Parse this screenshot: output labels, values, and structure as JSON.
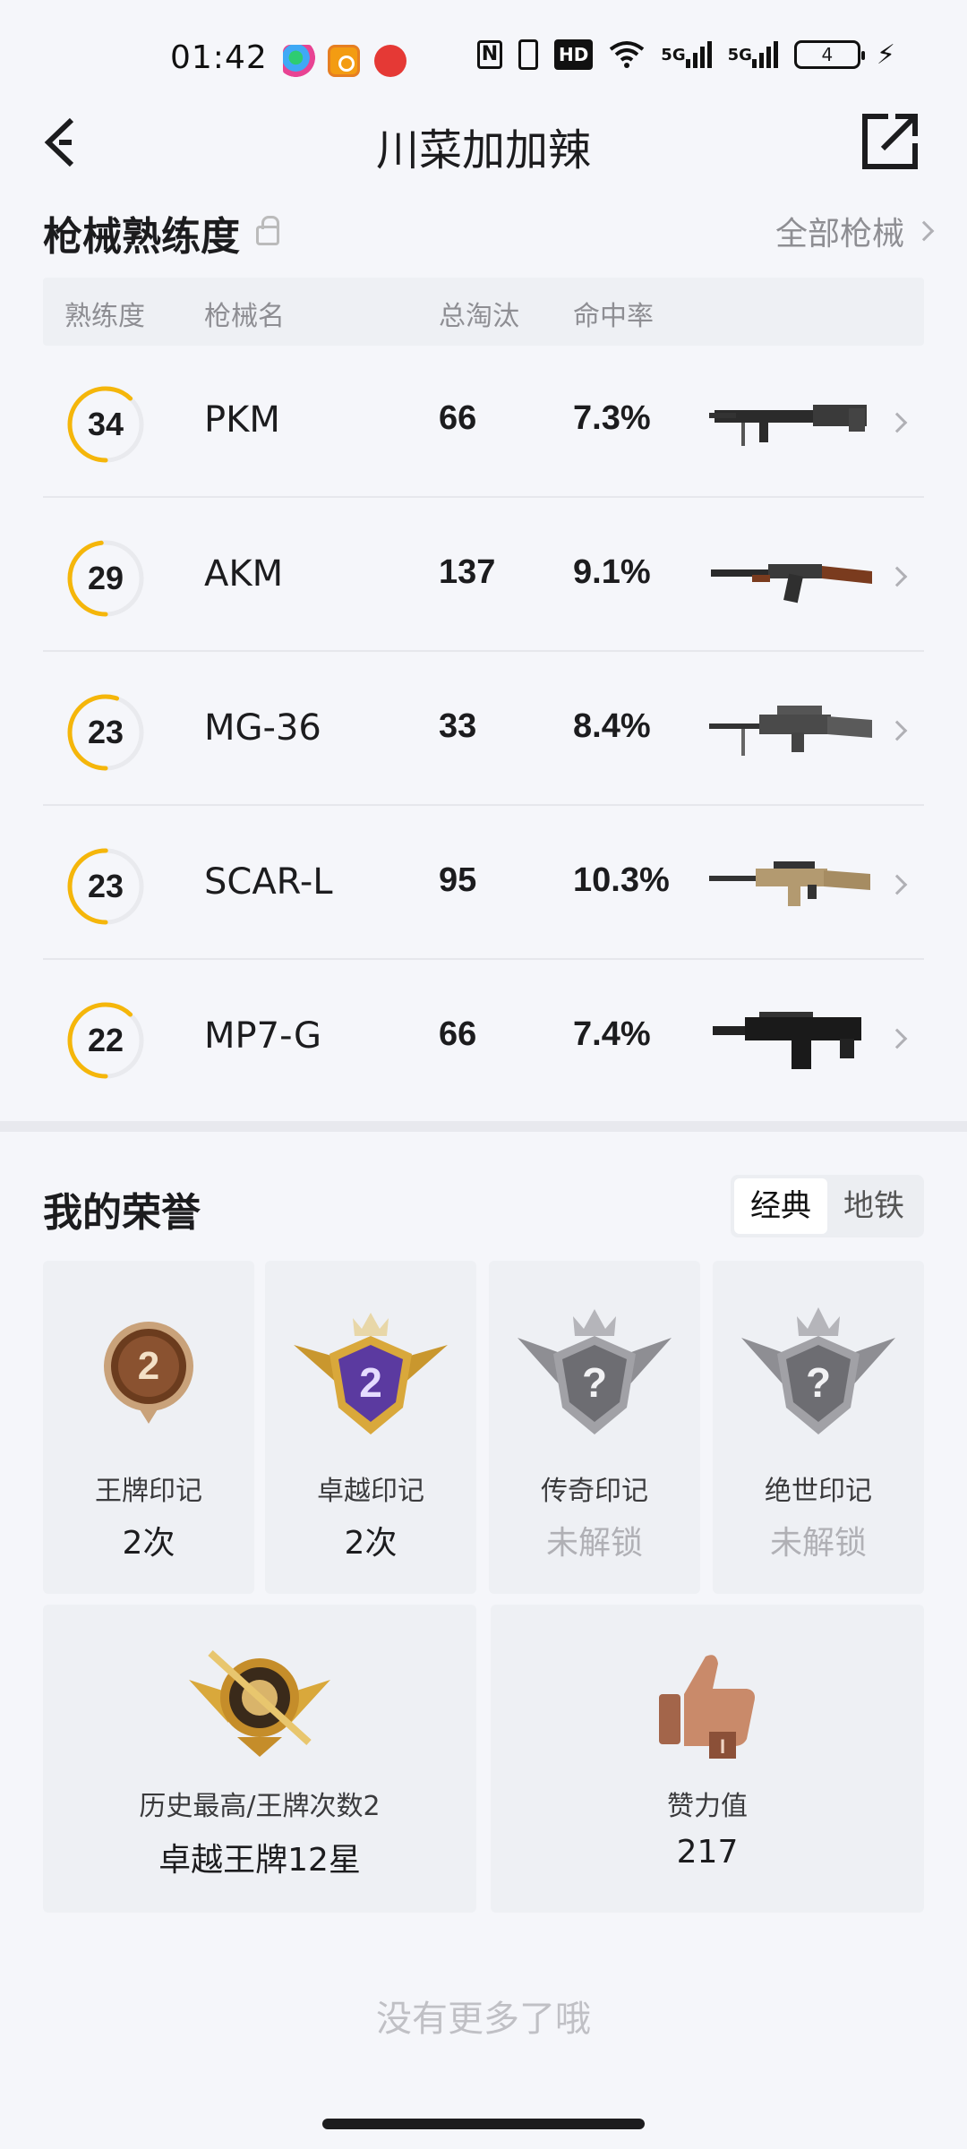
{
  "status_bar": {
    "time": "01:42",
    "hd_label": "HD",
    "signal1": "5G",
    "signal2": "5G",
    "battery": "4"
  },
  "header": {
    "title": "川菜加加辣"
  },
  "guns_section": {
    "title": "枪械熟练度",
    "all_link": "全部枪械",
    "columns": [
      "熟练度",
      "枪械名",
      "总淘汰",
      "命中率"
    ],
    "rows": [
      {
        "level": "34",
        "progress": 0.62,
        "name": "PKM",
        "kills": "66",
        "rate": "7.3%"
      },
      {
        "level": "29",
        "progress": 0.48,
        "name": "AKM",
        "kills": "137",
        "rate": "9.1%"
      },
      {
        "level": "23",
        "progress": 0.55,
        "name": "MG-36",
        "kills": "33",
        "rate": "8.4%"
      },
      {
        "level": "23",
        "progress": 0.5,
        "name": "SCAR-L",
        "kills": "95",
        "rate": "10.3%"
      },
      {
        "level": "22",
        "progress": 0.62,
        "name": "MP7-G",
        "kills": "66",
        "rate": "7.4%"
      }
    ]
  },
  "honors_section": {
    "title": "我的荣誉",
    "tabs": [
      "经典",
      "地铁"
    ],
    "active_tab": 0,
    "badges": [
      {
        "label": "王牌印记",
        "value": "2次",
        "locked": false,
        "icon": "ace-mark-icon",
        "number": "2"
      },
      {
        "label": "卓越印记",
        "value": "2次",
        "locked": false,
        "icon": "excellence-mark-icon",
        "number": "2"
      },
      {
        "label": "传奇印记",
        "value": "未解锁",
        "locked": true,
        "icon": "legend-mark-icon",
        "number": "?"
      },
      {
        "label": "绝世印记",
        "value": "未解锁",
        "locked": true,
        "icon": "peerless-mark-icon",
        "number": "?"
      }
    ],
    "highest": {
      "label": "历史最高/王牌次数2",
      "value": "卓越王牌12星",
      "icon": "highest-rank-icon"
    },
    "likes": {
      "label": "赞力值",
      "value": "217",
      "icon": "thumbs-up-icon"
    }
  },
  "footer": {
    "no_more": "没有更多了哦"
  },
  "colors": {
    "accent_ring": "#f5b60a",
    "ring_track": "#e9eaee",
    "background": "#f5f6fa"
  }
}
